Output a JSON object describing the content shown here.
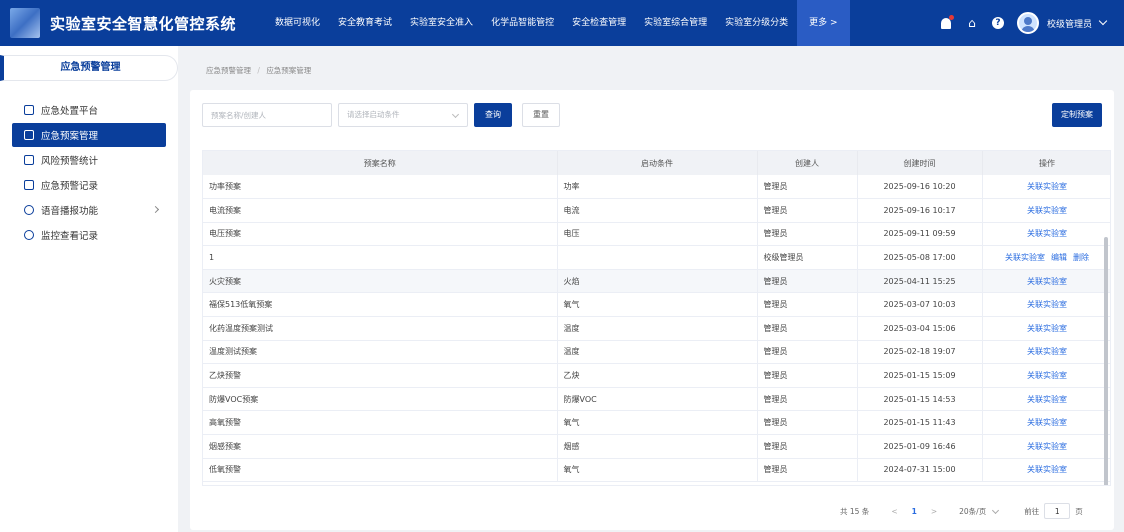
{
  "app": {
    "title": "实验室安全智慧化管控系统"
  },
  "topnav": {
    "items": [
      "数据可视化",
      "安全教育考试",
      "实验室安全准入",
      "化学品智能管控",
      "安全检查管理",
      "实验室综合管理",
      "实验室分级分类"
    ],
    "more": "更多 >"
  },
  "user": {
    "name": "校级管理员"
  },
  "sidebar": {
    "title": "应急预警管理",
    "items": [
      {
        "label": "应急处置平台"
      },
      {
        "label": "应急预案管理"
      },
      {
        "label": "风险预警统计"
      },
      {
        "label": "应急预警记录"
      },
      {
        "label": "语音播报功能"
      },
      {
        "label": "监控查看记录"
      }
    ]
  },
  "breadcrumb": {
    "parent": "应急预警管理",
    "sep": "/",
    "current": "应急预案管理"
  },
  "filters": {
    "name_placeholder": "预案名称/创建人",
    "condition_placeholder": "请选择启动条件",
    "query_label": "查询",
    "reset_label": "重置",
    "custom_label": "定制预案"
  },
  "table": {
    "headers": [
      "预案名称",
      "启动条件",
      "创建人",
      "创建时间",
      "操作"
    ],
    "rows": [
      {
        "name": "功率预案",
        "condition": "功率",
        "creator": "管理员",
        "time": "2025-09-16 10:20",
        "ops": [
          "关联实验室"
        ]
      },
      {
        "name": "电流预案",
        "condition": "电流",
        "creator": "管理员",
        "time": "2025-09-16 10:17",
        "ops": [
          "关联实验室"
        ]
      },
      {
        "name": "电压预案",
        "condition": "电压",
        "creator": "管理员",
        "time": "2025-09-11 09:59",
        "ops": [
          "关联实验室"
        ]
      },
      {
        "name": "1",
        "condition": "",
        "creator": "校级管理员",
        "time": "2025-05-08 17:00",
        "ops": [
          "关联实验室",
          "编辑",
          "删除"
        ]
      },
      {
        "name": "火灾预案",
        "condition": "火焰",
        "creator": "管理员",
        "time": "2025-04-11 15:25",
        "ops": [
          "关联实验室"
        ]
      },
      {
        "name": "福保513低氧预案",
        "condition": "氧气",
        "creator": "管理员",
        "time": "2025-03-07 10:03",
        "ops": [
          "关联实验室"
        ]
      },
      {
        "name": "化药温度预案测试",
        "condition": "温度",
        "creator": "管理员",
        "time": "2025-03-04 15:06",
        "ops": [
          "关联实验室"
        ]
      },
      {
        "name": "温度测试预案",
        "condition": "温度",
        "creator": "管理员",
        "time": "2025-02-18 19:07",
        "ops": [
          "关联实验室"
        ]
      },
      {
        "name": "乙炔预警",
        "condition": "乙炔",
        "creator": "管理员",
        "time": "2025-01-15 15:09",
        "ops": [
          "关联实验室"
        ]
      },
      {
        "name": "防爆VOC预案",
        "condition": "防爆VOC",
        "creator": "管理员",
        "time": "2025-01-15 14:53",
        "ops": [
          "关联实验室"
        ]
      },
      {
        "name": "高氧预警",
        "condition": "氧气",
        "creator": "管理员",
        "time": "2025-01-15 11:43",
        "ops": [
          "关联实验室"
        ]
      },
      {
        "name": "烟感预案",
        "condition": "烟感",
        "creator": "管理员",
        "time": "2025-01-09 16:46",
        "ops": [
          "关联实验室"
        ]
      },
      {
        "name": "低氧预警",
        "condition": "氧气",
        "creator": "管理员",
        "time": "2024-07-31 15:00",
        "ops": [
          "关联实验室"
        ]
      }
    ]
  },
  "pagination": {
    "total": "共 15 条",
    "prev": "<",
    "page": "1",
    "next": ">",
    "page_size": "20条/页",
    "goto_label": "前往",
    "goto_value": "1",
    "page_suffix": "页"
  },
  "colors": {
    "primary": "#0a3e9b",
    "link": "#2a6ce0"
  }
}
